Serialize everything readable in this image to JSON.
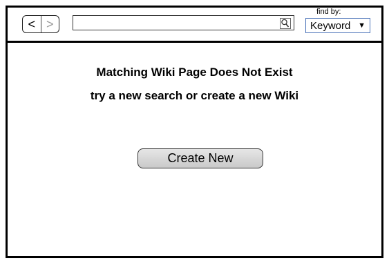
{
  "toolbar": {
    "back_glyph": "<",
    "forward_glyph": ">",
    "search_value": "",
    "find_by_label": "find by:",
    "find_by_selected": "Keyword",
    "icons": [
      "back-icon",
      "forward-icon",
      "search-icon",
      "dropdown-arrow-icon"
    ]
  },
  "message": {
    "title": "Matching Wiki Page Does Not Exist",
    "subtitle": "try a new search or create a new Wiki"
  },
  "actions": {
    "create_label": "Create New"
  }
}
